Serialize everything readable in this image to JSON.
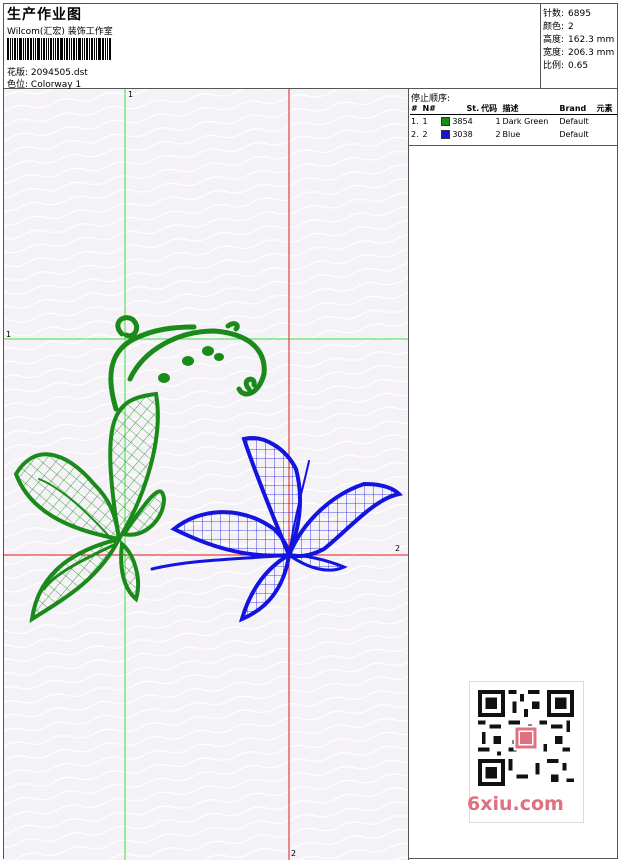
{
  "header": {
    "title": "生产作业图",
    "studio": "Wilcom(汇宏) 装饰工作室",
    "design_label": "花版:",
    "design_file": "2094505.dst",
    "colorway_label": "色位:",
    "colorway": "Colorway 1"
  },
  "stats": [
    {
      "label": "针数:",
      "value": "6895"
    },
    {
      "label": "颜色:",
      "value": "2"
    },
    {
      "label": "高度:",
      "value": "162.3 mm"
    },
    {
      "label": "宽度:",
      "value": "206.3 mm"
    },
    {
      "label": "比例:",
      "value": "0.65"
    }
  ],
  "stop_sequence": {
    "title": "停止顺序:",
    "columns": [
      "#",
      "N#",
      "St.",
      "代码",
      "描述",
      "Brand",
      "元素"
    ],
    "rows": [
      {
        "num": "1.",
        "n": "1",
        "color": "#1a8a1a",
        "stitches": "3854",
        "code": "1",
        "desc": "Dark Green",
        "brand": "Default",
        "element": ""
      },
      {
        "num": "2.",
        "n": "2",
        "color": "#1414e0",
        "stitches": "3038",
        "code": "2",
        "desc": "Blue",
        "brand": "Default",
        "element": ""
      }
    ]
  },
  "canvas": {
    "labels": {
      "green_top": "1",
      "green_left": "1",
      "red_right": "2",
      "red_bottom": "2"
    },
    "colors": {
      "green": "#1a8a1a",
      "blue": "#1414e0",
      "green_guide": "#3ee03e",
      "red_guide": "#e01a1a"
    }
  },
  "watermark": {
    "text": "6xiu.com"
  }
}
